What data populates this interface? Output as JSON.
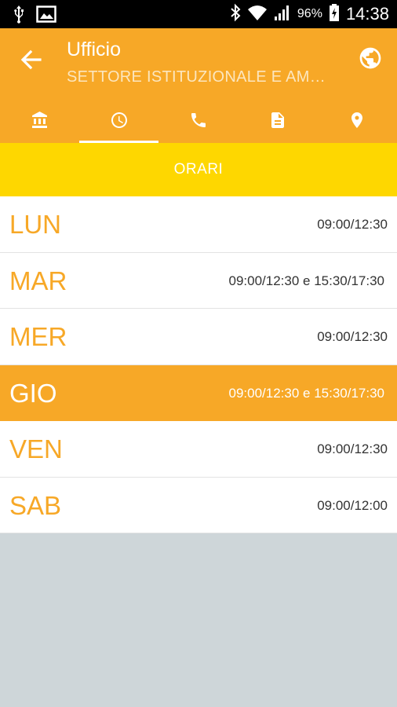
{
  "statusbar": {
    "battery_pct": "96%",
    "time": "14:38",
    "icons": [
      "usb-icon",
      "image-icon",
      "bluetooth-icon",
      "wifi-icon",
      "signal-icon",
      "battery-icon"
    ]
  },
  "appbar": {
    "title": "Ufficio",
    "subtitle": "SETTORE ISTITUZIONALE E AM…",
    "tabs": [
      {
        "icon": "bank-icon",
        "active": false
      },
      {
        "icon": "clock-icon",
        "active": true
      },
      {
        "icon": "phone-icon",
        "active": false
      },
      {
        "icon": "document-icon",
        "active": false
      },
      {
        "icon": "location-pin-icon",
        "active": false
      }
    ]
  },
  "section": {
    "title": "ORARI"
  },
  "schedule": [
    {
      "day": "LUN",
      "hours": "09:00/12:30"
    },
    {
      "day": "MAR",
      "hours": "09:00/12:30 e 15:30/17:30"
    },
    {
      "day": "MER",
      "hours": "09:00/12:30"
    },
    {
      "day": "GIO",
      "hours": "09:00/12:30 e 15:30/17:30",
      "highlight": true
    },
    {
      "day": "VEN",
      "hours": "09:00/12:30"
    },
    {
      "day": "SAB",
      "hours": "09:00/12:00"
    }
  ],
  "colors": {
    "primary": "#f7a827",
    "section_header": "#fed700",
    "background": "#ced6d9"
  }
}
